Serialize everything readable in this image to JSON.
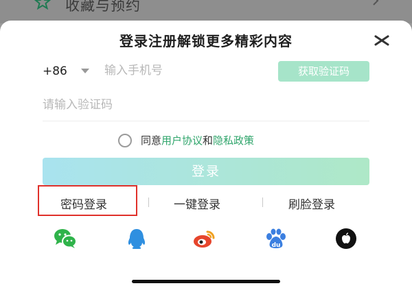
{
  "background": {
    "item_label": "收藏与预约",
    "star_icon": "star-outline-icon",
    "chevron_icon": "chevron-right-icon"
  },
  "login_sheet": {
    "title": "登录注册解锁更多精彩内容",
    "close_icon": "close-icon",
    "country_code": "+86",
    "phone_placeholder": "输入手机号",
    "get_code_label": "获取验证码",
    "code_placeholder": "请输入验证码",
    "agreement": {
      "prefix": "同意",
      "user_agreement": "用户协议",
      "conjunction": "和",
      "privacy_policy": "隐私政策"
    },
    "login_label": "登录",
    "alt_methods": [
      "密码登录",
      "一键登录",
      "刷脸登录"
    ],
    "social_icons": [
      "wechat-icon",
      "qq-icon",
      "weibo-icon",
      "baidu-icon",
      "apple-icon"
    ]
  },
  "colors": {
    "accent_green": "#2fa56b",
    "button_light_green": "#a6e4c9",
    "highlight_red": "#e0302a"
  }
}
